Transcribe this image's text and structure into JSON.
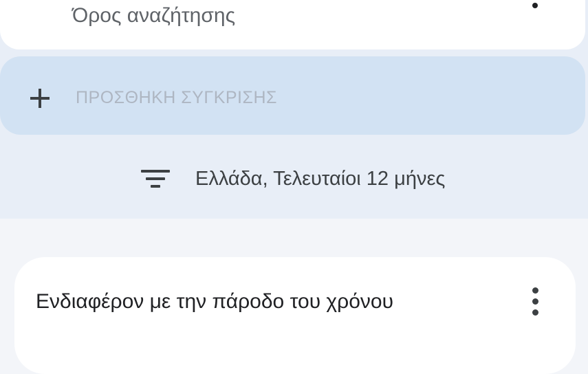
{
  "search_term": {
    "subtitle": "Όρος αναζήτησης",
    "menu_icon": "more-vert-icon"
  },
  "compare": {
    "icon": "plus-icon",
    "label": "ΠΡΟΣΘΗΚΗ ΣΥΓΚΡΙΣΗΣ"
  },
  "filter": {
    "icon": "filter-icon",
    "label": "Ελλάδα, Τελευταίοι 12 μήνες"
  },
  "interest_card": {
    "title": "Ενδιαφέρον με την πάροδο του χρόνου",
    "menu_icon": "more-vert-icon"
  },
  "colors": {
    "band": "#e8eef7",
    "compare_bg": "#d2e2f3",
    "card": "#ffffff",
    "text_primary": "#202124",
    "text_secondary": "#5f6368",
    "text_disabled": "#aeb6c2"
  }
}
